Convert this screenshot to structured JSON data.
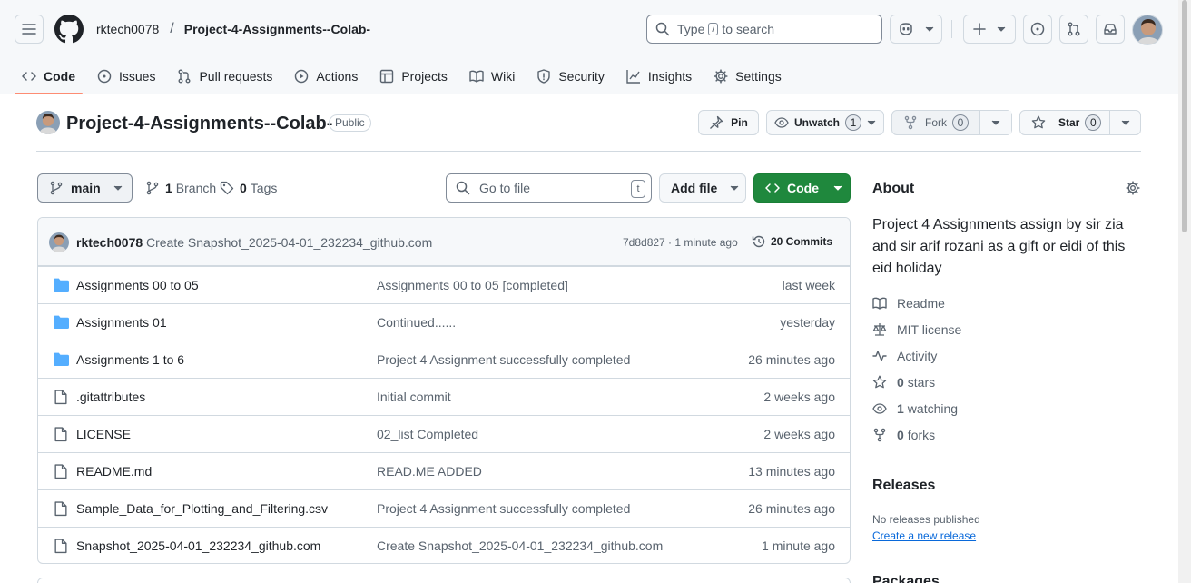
{
  "header": {
    "owner": "rktech0078",
    "separator": "/",
    "repo": "Project-4-Assignments--Colab-",
    "search_prefix": "Type",
    "search_key": "/",
    "search_suffix": "to search"
  },
  "tabs": [
    {
      "label": "Code",
      "icon": "code-icon",
      "active": true
    },
    {
      "label": "Issues",
      "icon": "issue-icon"
    },
    {
      "label": "Pull requests",
      "icon": "pull-request-icon"
    },
    {
      "label": "Actions",
      "icon": "play-icon"
    },
    {
      "label": "Projects",
      "icon": "table-icon"
    },
    {
      "label": "Wiki",
      "icon": "book-icon"
    },
    {
      "label": "Security",
      "icon": "shield-icon"
    },
    {
      "label": "Insights",
      "icon": "graph-icon"
    },
    {
      "label": "Settings",
      "icon": "gear-icon"
    }
  ],
  "repo": {
    "title": "Project-4-Assignments--Colab-",
    "visibility": "Public",
    "pin_label": "Pin",
    "unwatch_label": "Unwatch",
    "watch_count": "1",
    "fork_label": "Fork",
    "fork_count": "0",
    "star_label": "Star",
    "star_count": "0"
  },
  "filenav": {
    "branch": "main",
    "branch_count": "1",
    "branch_label": "Branch",
    "tag_count": "0",
    "tag_label": "Tags",
    "goto_placeholder": "Go to file",
    "goto_key": "t",
    "add_file": "Add file",
    "code": "Code"
  },
  "latest_commit": {
    "author": "rktech0078",
    "message": "Create Snapshot_2025-04-01_232234_github.com",
    "sha_time": "7d8d827 · 1 minute ago",
    "commits": "20 Commits"
  },
  "files": [
    {
      "name": "Assignments 00 to 05",
      "type": "folder",
      "message": "Assignments 00 to 05 [completed]",
      "age": "last week"
    },
    {
      "name": "Assignments 01",
      "type": "folder",
      "message": "Continued......",
      "age": "yesterday"
    },
    {
      "name": "Assignments 1 to 6",
      "type": "folder",
      "message": "Project 4 Assignment successfully completed",
      "age": "26 minutes ago"
    },
    {
      "name": ".gitattributes",
      "type": "file",
      "message": "Initial commit",
      "age": "2 weeks ago"
    },
    {
      "name": "LICENSE",
      "type": "file",
      "message": "02_list Completed",
      "age": "2 weeks ago"
    },
    {
      "name": "README.md",
      "type": "file",
      "message": "READ.ME ADDED",
      "age": "13 minutes ago"
    },
    {
      "name": "Sample_Data_for_Plotting_and_Filtering.csv",
      "type": "file",
      "message": "Project 4 Assignment successfully completed",
      "age": "26 minutes ago"
    },
    {
      "name": "Snapshot_2025-04-01_232234_github.com",
      "type": "file",
      "message": "Create Snapshot_2025-04-01_232234_github.com",
      "age": "1 minute ago"
    }
  ],
  "about": {
    "heading": "About",
    "description": "Project 4 Assignments assign by sir zia and sir arif rozani as a gift or eidi of this eid holiday",
    "readme": "Readme",
    "license": "MIT license",
    "activity": "Activity",
    "stars_count": "0",
    "stars_label": "stars",
    "watching_count": "1",
    "watching_label": "watching",
    "forks_count": "0",
    "forks_label": "forks"
  },
  "releases": {
    "heading": "Releases",
    "none": "No releases published",
    "create": "Create a new release"
  },
  "packages": {
    "heading": "Packages"
  },
  "colors": {
    "accent_tab": "#fd8c73",
    "code_button": "#1f883d",
    "folder": "#54aeff",
    "link": "#0969da"
  }
}
